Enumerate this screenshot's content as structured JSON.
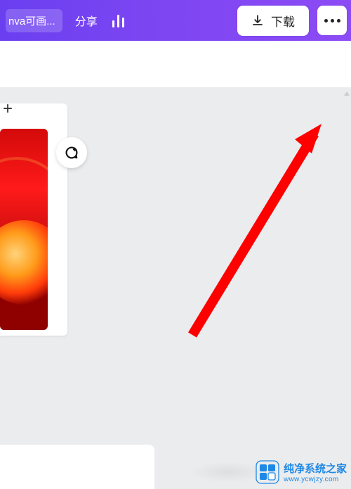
{
  "toolbar": {
    "title_fragment": "nva可画...",
    "share_label": "分享",
    "download_label": "下载"
  },
  "watermark": {
    "brand": "纯净系统之家",
    "url": "www.ycwjzy.com"
  },
  "colors": {
    "accent_start": "#6a3ff0",
    "accent_end": "#8c4bf5",
    "pointer": "#ff0000",
    "brand_blue": "#1e88e5"
  }
}
